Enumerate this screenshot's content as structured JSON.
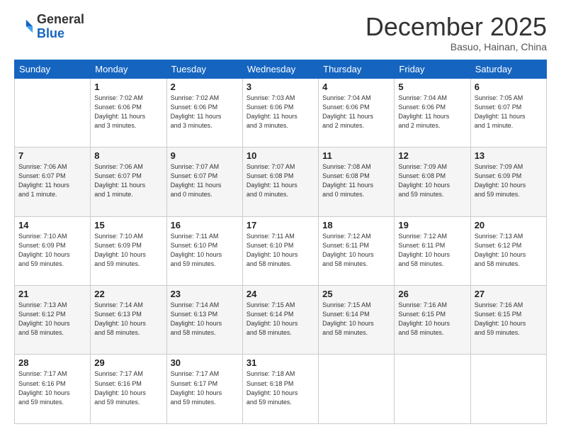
{
  "header": {
    "logo_general": "General",
    "logo_blue": "Blue",
    "month_title": "December 2025",
    "subtitle": "Basuo, Hainan, China"
  },
  "weekdays": [
    "Sunday",
    "Monday",
    "Tuesday",
    "Wednesday",
    "Thursday",
    "Friday",
    "Saturday"
  ],
  "weeks": [
    [
      {
        "day": "",
        "info": ""
      },
      {
        "day": "1",
        "info": "Sunrise: 7:02 AM\nSunset: 6:06 PM\nDaylight: 11 hours\nand 3 minutes."
      },
      {
        "day": "2",
        "info": "Sunrise: 7:02 AM\nSunset: 6:06 PM\nDaylight: 11 hours\nand 3 minutes."
      },
      {
        "day": "3",
        "info": "Sunrise: 7:03 AM\nSunset: 6:06 PM\nDaylight: 11 hours\nand 3 minutes."
      },
      {
        "day": "4",
        "info": "Sunrise: 7:04 AM\nSunset: 6:06 PM\nDaylight: 11 hours\nand 2 minutes."
      },
      {
        "day": "5",
        "info": "Sunrise: 7:04 AM\nSunset: 6:06 PM\nDaylight: 11 hours\nand 2 minutes."
      },
      {
        "day": "6",
        "info": "Sunrise: 7:05 AM\nSunset: 6:07 PM\nDaylight: 11 hours\nand 1 minute."
      }
    ],
    [
      {
        "day": "7",
        "info": "Sunrise: 7:06 AM\nSunset: 6:07 PM\nDaylight: 11 hours\nand 1 minute."
      },
      {
        "day": "8",
        "info": "Sunrise: 7:06 AM\nSunset: 6:07 PM\nDaylight: 11 hours\nand 1 minute."
      },
      {
        "day": "9",
        "info": "Sunrise: 7:07 AM\nSunset: 6:07 PM\nDaylight: 11 hours\nand 0 minutes."
      },
      {
        "day": "10",
        "info": "Sunrise: 7:07 AM\nSunset: 6:08 PM\nDaylight: 11 hours\nand 0 minutes."
      },
      {
        "day": "11",
        "info": "Sunrise: 7:08 AM\nSunset: 6:08 PM\nDaylight: 11 hours\nand 0 minutes."
      },
      {
        "day": "12",
        "info": "Sunrise: 7:09 AM\nSunset: 6:08 PM\nDaylight: 10 hours\nand 59 minutes."
      },
      {
        "day": "13",
        "info": "Sunrise: 7:09 AM\nSunset: 6:09 PM\nDaylight: 10 hours\nand 59 minutes."
      }
    ],
    [
      {
        "day": "14",
        "info": "Sunrise: 7:10 AM\nSunset: 6:09 PM\nDaylight: 10 hours\nand 59 minutes."
      },
      {
        "day": "15",
        "info": "Sunrise: 7:10 AM\nSunset: 6:09 PM\nDaylight: 10 hours\nand 59 minutes."
      },
      {
        "day": "16",
        "info": "Sunrise: 7:11 AM\nSunset: 6:10 PM\nDaylight: 10 hours\nand 59 minutes."
      },
      {
        "day": "17",
        "info": "Sunrise: 7:11 AM\nSunset: 6:10 PM\nDaylight: 10 hours\nand 58 minutes."
      },
      {
        "day": "18",
        "info": "Sunrise: 7:12 AM\nSunset: 6:11 PM\nDaylight: 10 hours\nand 58 minutes."
      },
      {
        "day": "19",
        "info": "Sunrise: 7:12 AM\nSunset: 6:11 PM\nDaylight: 10 hours\nand 58 minutes."
      },
      {
        "day": "20",
        "info": "Sunrise: 7:13 AM\nSunset: 6:12 PM\nDaylight: 10 hours\nand 58 minutes."
      }
    ],
    [
      {
        "day": "21",
        "info": "Sunrise: 7:13 AM\nSunset: 6:12 PM\nDaylight: 10 hours\nand 58 minutes."
      },
      {
        "day": "22",
        "info": "Sunrise: 7:14 AM\nSunset: 6:13 PM\nDaylight: 10 hours\nand 58 minutes."
      },
      {
        "day": "23",
        "info": "Sunrise: 7:14 AM\nSunset: 6:13 PM\nDaylight: 10 hours\nand 58 minutes."
      },
      {
        "day": "24",
        "info": "Sunrise: 7:15 AM\nSunset: 6:14 PM\nDaylight: 10 hours\nand 58 minutes."
      },
      {
        "day": "25",
        "info": "Sunrise: 7:15 AM\nSunset: 6:14 PM\nDaylight: 10 hours\nand 58 minutes."
      },
      {
        "day": "26",
        "info": "Sunrise: 7:16 AM\nSunset: 6:15 PM\nDaylight: 10 hours\nand 58 minutes."
      },
      {
        "day": "27",
        "info": "Sunrise: 7:16 AM\nSunset: 6:15 PM\nDaylight: 10 hours\nand 59 minutes."
      }
    ],
    [
      {
        "day": "28",
        "info": "Sunrise: 7:17 AM\nSunset: 6:16 PM\nDaylight: 10 hours\nand 59 minutes."
      },
      {
        "day": "29",
        "info": "Sunrise: 7:17 AM\nSunset: 6:16 PM\nDaylight: 10 hours\nand 59 minutes."
      },
      {
        "day": "30",
        "info": "Sunrise: 7:17 AM\nSunset: 6:17 PM\nDaylight: 10 hours\nand 59 minutes."
      },
      {
        "day": "31",
        "info": "Sunrise: 7:18 AM\nSunset: 6:18 PM\nDaylight: 10 hours\nand 59 minutes."
      },
      {
        "day": "",
        "info": ""
      },
      {
        "day": "",
        "info": ""
      },
      {
        "day": "",
        "info": ""
      }
    ]
  ]
}
